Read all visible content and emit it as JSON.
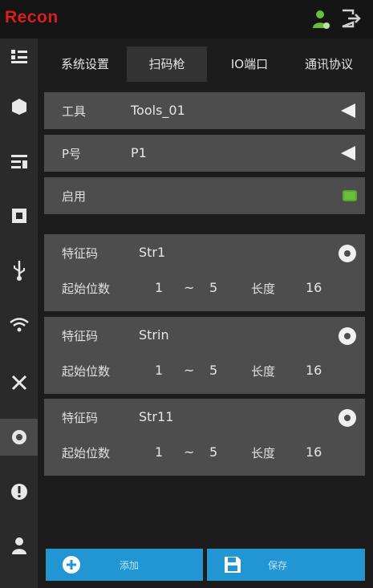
{
  "brand": {
    "logo_text": "Recon",
    "logo_color": "#d81e1e"
  },
  "header": {
    "user_icon": "user-icon",
    "exit_icon": "exit-icon"
  },
  "sidebar": {
    "items": [
      {
        "icon": "list-icon"
      },
      {
        "icon": "box-icon"
      },
      {
        "icon": "list-settings-icon"
      },
      {
        "icon": "chip-icon"
      },
      {
        "icon": "usb-icon"
      },
      {
        "icon": "wifi-icon"
      },
      {
        "icon": "tools-icon"
      },
      {
        "icon": "gear-icon",
        "active": true
      },
      {
        "icon": "info-icon"
      },
      {
        "icon": "person-icon"
      }
    ]
  },
  "tabs": [
    {
      "label": "系统设置"
    },
    {
      "label": "扫码枪",
      "active": true
    },
    {
      "label": "IO端口"
    },
    {
      "label": "通讯协议"
    }
  ],
  "fields": {
    "tool": {
      "label": "工具",
      "value": "Tools_01"
    },
    "p_number": {
      "label": "P号",
      "value": "P1"
    },
    "enable": {
      "label": "启用",
      "state": "on",
      "color": "#6abf3a"
    }
  },
  "feature_codes": [
    {
      "code_label": "特征码",
      "code": "Str1",
      "start_label": "起始位数",
      "from": "1",
      "dash": "~",
      "to": "5",
      "length_label": "长度",
      "length": "16"
    },
    {
      "code_label": "特征码",
      "code": "Strin",
      "start_label": "起始位数",
      "from": "1",
      "dash": "~",
      "to": "5",
      "length_label": "长度",
      "length": "16"
    },
    {
      "code_label": "特征码",
      "code": "Str11",
      "start_label": "起始位数",
      "from": "1",
      "dash": "~",
      "to": "5",
      "length_label": "长度",
      "length": "16"
    }
  ],
  "buttons": {
    "add": {
      "label": "添加",
      "icon": "plus-circle-icon"
    },
    "save": {
      "label": "保存",
      "icon": "save-icon"
    },
    "color": "#2196d3"
  }
}
